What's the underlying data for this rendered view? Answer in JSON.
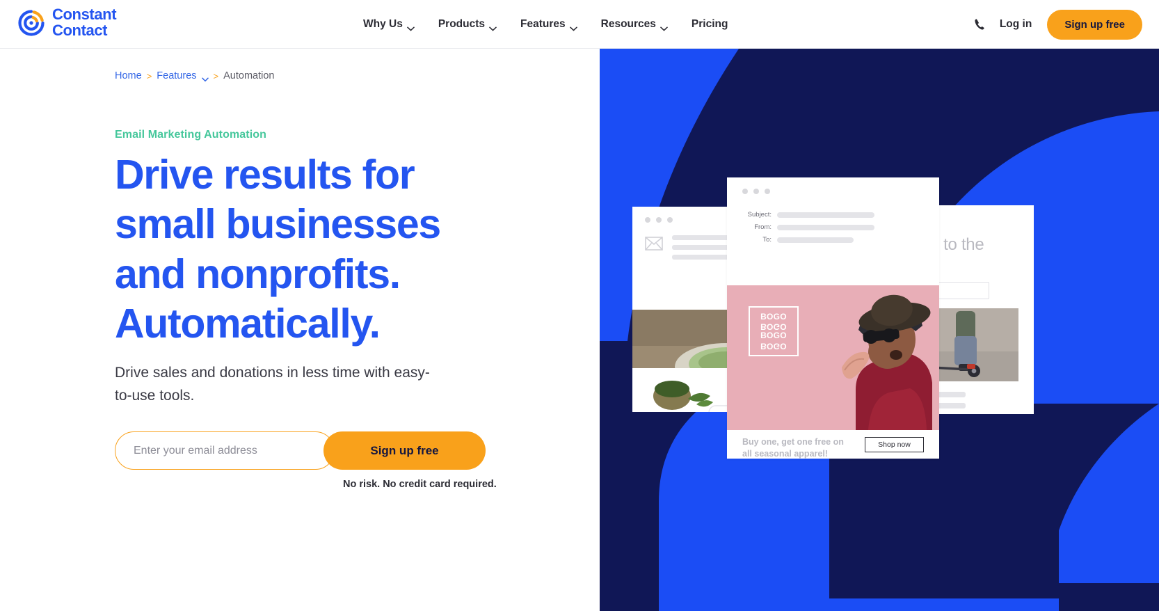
{
  "brand": {
    "name_line1": "Constant",
    "name_line2": "Contact",
    "logo_blue": "#2455F0",
    "logo_orange": "#F9A11B"
  },
  "header": {
    "nav": [
      {
        "label": "Why Us",
        "has_caret": true
      },
      {
        "label": "Products",
        "has_caret": true
      },
      {
        "label": "Features",
        "has_caret": true
      },
      {
        "label": "Resources",
        "has_caret": true
      },
      {
        "label": "Pricing",
        "has_caret": false
      }
    ],
    "phone_icon": "phone-icon",
    "login_label": "Log in",
    "signup_label": "Sign up free",
    "signup_bg": "#F9A11B"
  },
  "breadcrumb": {
    "home": "Home",
    "features": "Features",
    "current": "Automation",
    "separator": ">"
  },
  "hero": {
    "eyebrow": "Email Marketing Automation",
    "eyebrow_color": "#45C79B",
    "headline": "Drive results for small businesses and nonprofits. Automatically.",
    "headline_color": "#2455F0",
    "subhead": "Drive sales and donations in less time with easy-to-use tools.",
    "email_placeholder": "Enter your email address",
    "email_value": "",
    "submit_label": "Sign up free",
    "disclaimer": "No risk. No credit card required."
  },
  "visual": {
    "bg_navy": "#101756",
    "bg_blue": "#1B4DF5",
    "email_card": {
      "subject_label": "Subject:",
      "from_label": "From:",
      "to_label": "To:"
    },
    "promo_card": {
      "bogo_lines": [
        "BOGO",
        "BOGO",
        "BOGO",
        "BOGO"
      ],
      "caption": "Buy one, get one free on all seasonal apparel!",
      "shop_label": "Shop now",
      "panel_color": "#E8AEB7"
    },
    "welcome_card": {
      "text": "Welome to the club!"
    }
  }
}
